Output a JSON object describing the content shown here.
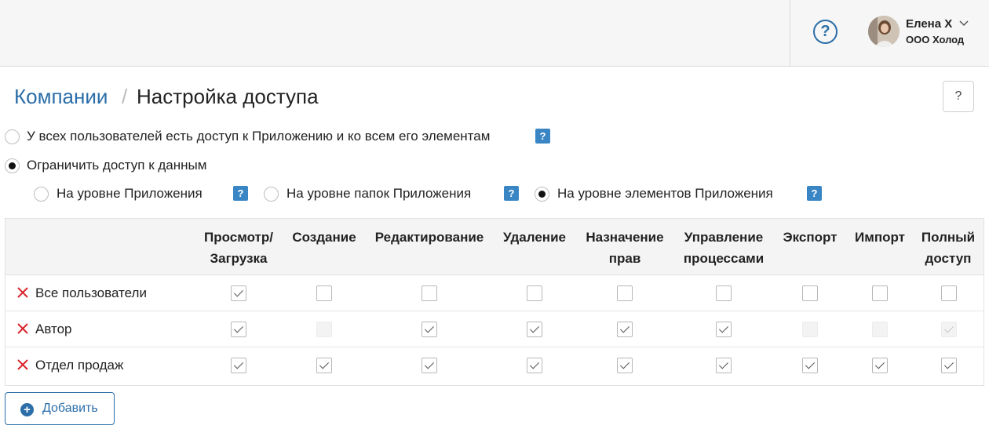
{
  "header": {
    "help_symbol": "?",
    "user_name": "Елена Х",
    "user_org": "ООО Холод"
  },
  "breadcrumb": {
    "parent": "Компании",
    "separator": "/",
    "current": "Настройка доступа"
  },
  "page_help_symbol": "?",
  "access_options": {
    "all_users": "У всех пользователей есть доступ к Приложению и ко всем его элементам",
    "restrict": "Ограничить доступ к данным",
    "selected": "restrict",
    "badge_symbol": "?"
  },
  "levels": {
    "app": "На уровне Приложения",
    "folders": "На уровне папок Приложения",
    "items": "На уровне элементов Приложения",
    "selected": "items"
  },
  "table": {
    "columns": [
      "Просмотр/ Загрузка",
      "Создание",
      "Редактирование",
      "Удаление",
      "Назначение прав",
      "Управление процессами",
      "Экспорт",
      "Импорт",
      "Полный доступ"
    ],
    "rows": [
      {
        "name": "Все пользователи",
        "values": [
          true,
          false,
          false,
          false,
          false,
          false,
          false,
          false,
          false
        ],
        "disabled": [
          false,
          false,
          false,
          false,
          false,
          false,
          false,
          false,
          false
        ]
      },
      {
        "name": "Автор",
        "values": [
          true,
          false,
          true,
          true,
          true,
          true,
          false,
          false,
          true
        ],
        "disabled": [
          false,
          true,
          false,
          false,
          false,
          false,
          true,
          true,
          true
        ]
      },
      {
        "name": "Отдел продаж",
        "values": [
          true,
          true,
          true,
          true,
          true,
          true,
          true,
          true,
          true
        ],
        "disabled": [
          false,
          false,
          false,
          false,
          false,
          false,
          false,
          false,
          false
        ]
      }
    ]
  },
  "add_button": {
    "icon": "+",
    "label": "Добавить"
  },
  "colors": {
    "accent": "#2b6ea8",
    "badge": "#3a86c4",
    "remove": "#d9262b"
  }
}
